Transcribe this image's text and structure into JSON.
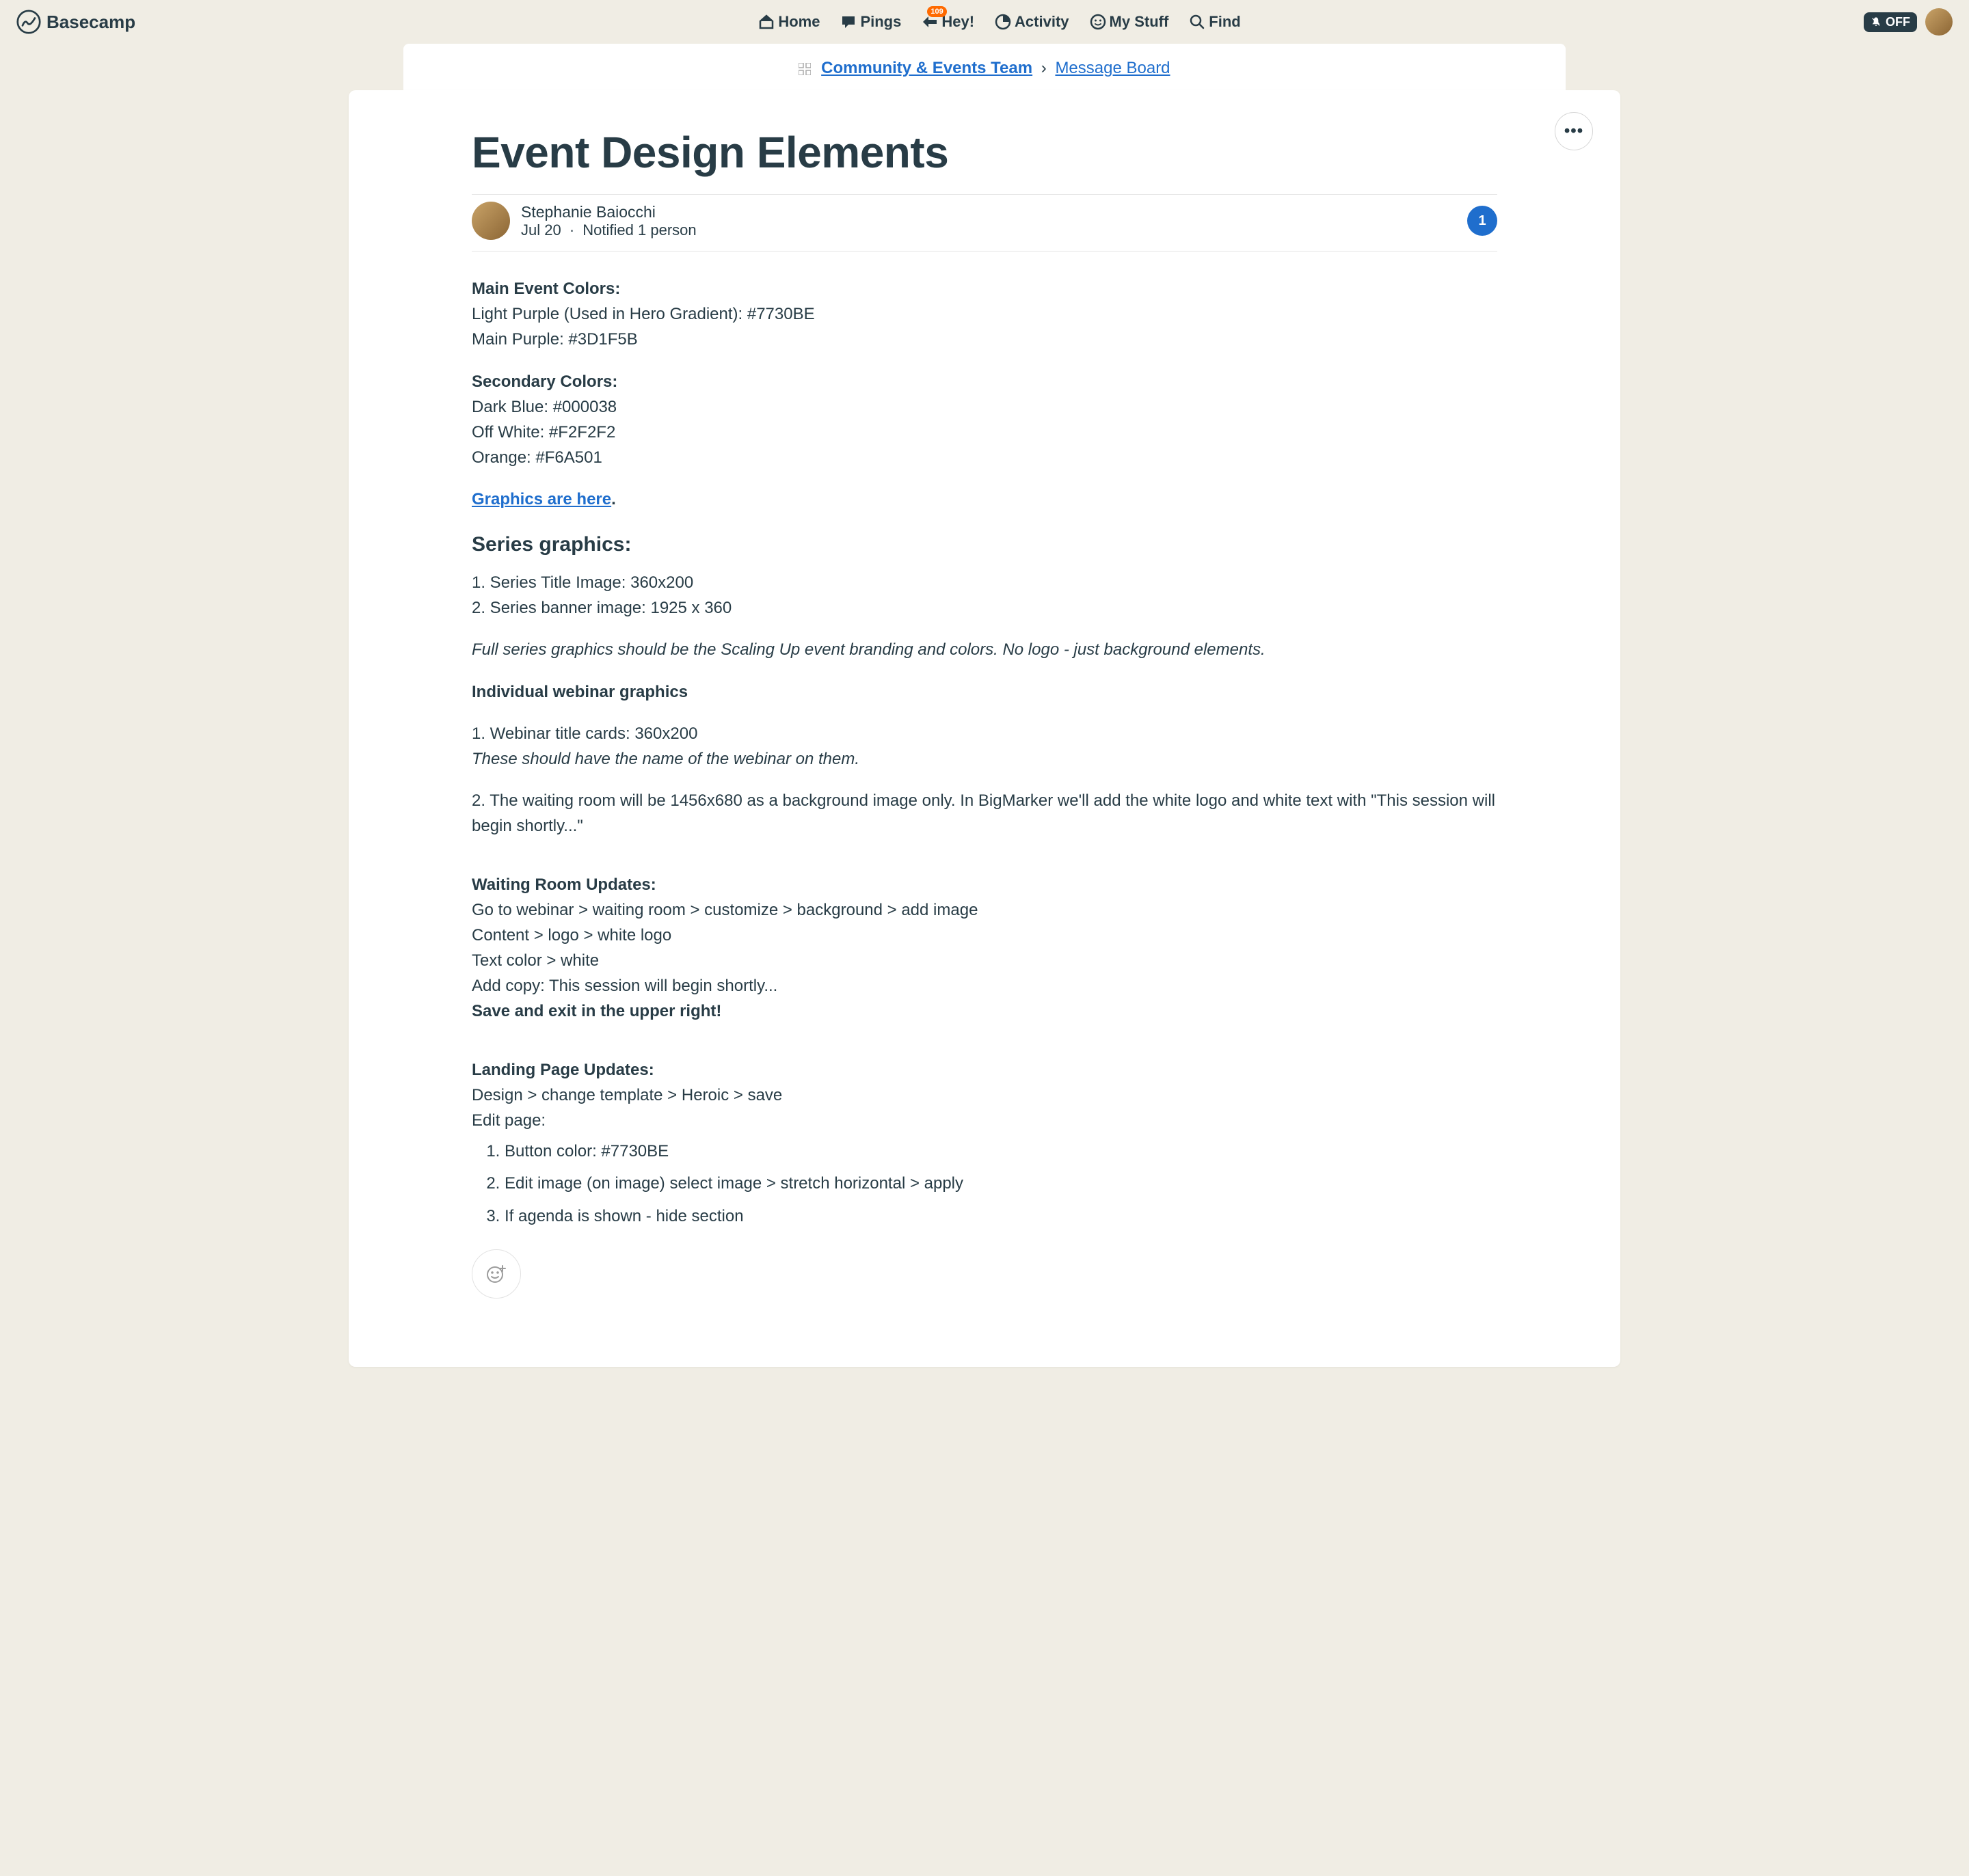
{
  "brand": "Basecamp",
  "nav": {
    "home": "Home",
    "pings": "Pings",
    "hey": "Hey!",
    "hey_badge": "109",
    "activity": "Activity",
    "mystuff": "My Stuff",
    "find": "Find"
  },
  "right": {
    "off_label": "OFF"
  },
  "breadcrumb": {
    "team": "Community & Events Team",
    "separator": "›",
    "page": "Message Board"
  },
  "post": {
    "title": "Event Design Elements",
    "author_name": "Stephanie Baiocchi",
    "date": "Jul 20",
    "notified": "Notified 1 person",
    "meta_separator": "·",
    "count_badge": "1"
  },
  "body": {
    "main_colors_heading": "Main Event Colors:",
    "light_purple": "Light Purple (Used in Hero Gradient): #7730BE",
    "main_purple": "Main Purple: #3D1F5B",
    "secondary_colors_heading": "Secondary Colors:",
    "dark_blue": "Dark Blue: #000038",
    "off_white": "Off White: #F2F2F2",
    "orange": "Orange: #F6A501",
    "graphics_link": "Graphics are here",
    "period": ".",
    "series_heading": "Series graphics:",
    "series_item1": "1. Series Title Image: 360x200",
    "series_item2": "2. Series banner image: 1925 x 360",
    "series_note": "Full series graphics should be the Scaling Up event branding and colors. No logo - just background elements.",
    "individual_heading": "Individual webinar graphics",
    "individual_item1": "1. Webinar title cards: 360x200",
    "individual_note": "These should have the name of the webinar on them.",
    "individual_item2": "2. The waiting room will be 1456x680 as a background image only. In BigMarker we'll add the white logo and white text with \"This session will begin shortly...\"",
    "waiting_heading": "Waiting Room Updates:",
    "waiting_line1": "Go to webinar > waiting room > customize > background > add image",
    "waiting_line2": "Content > logo > white logo",
    "waiting_line3": "Text color > white",
    "waiting_line4": "Add copy: This session will begin shortly...",
    "waiting_save": "Save and exit in the upper right!",
    "landing_heading": "Landing Page Updates:",
    "landing_line1": "Design > change template > Heroic > save",
    "landing_line2": "Edit page:",
    "landing_ol1": "Button color: #7730BE",
    "landing_ol2": "Edit image (on image) select image > stretch horizontal > apply",
    "landing_ol3": "If agenda is shown - hide section"
  }
}
